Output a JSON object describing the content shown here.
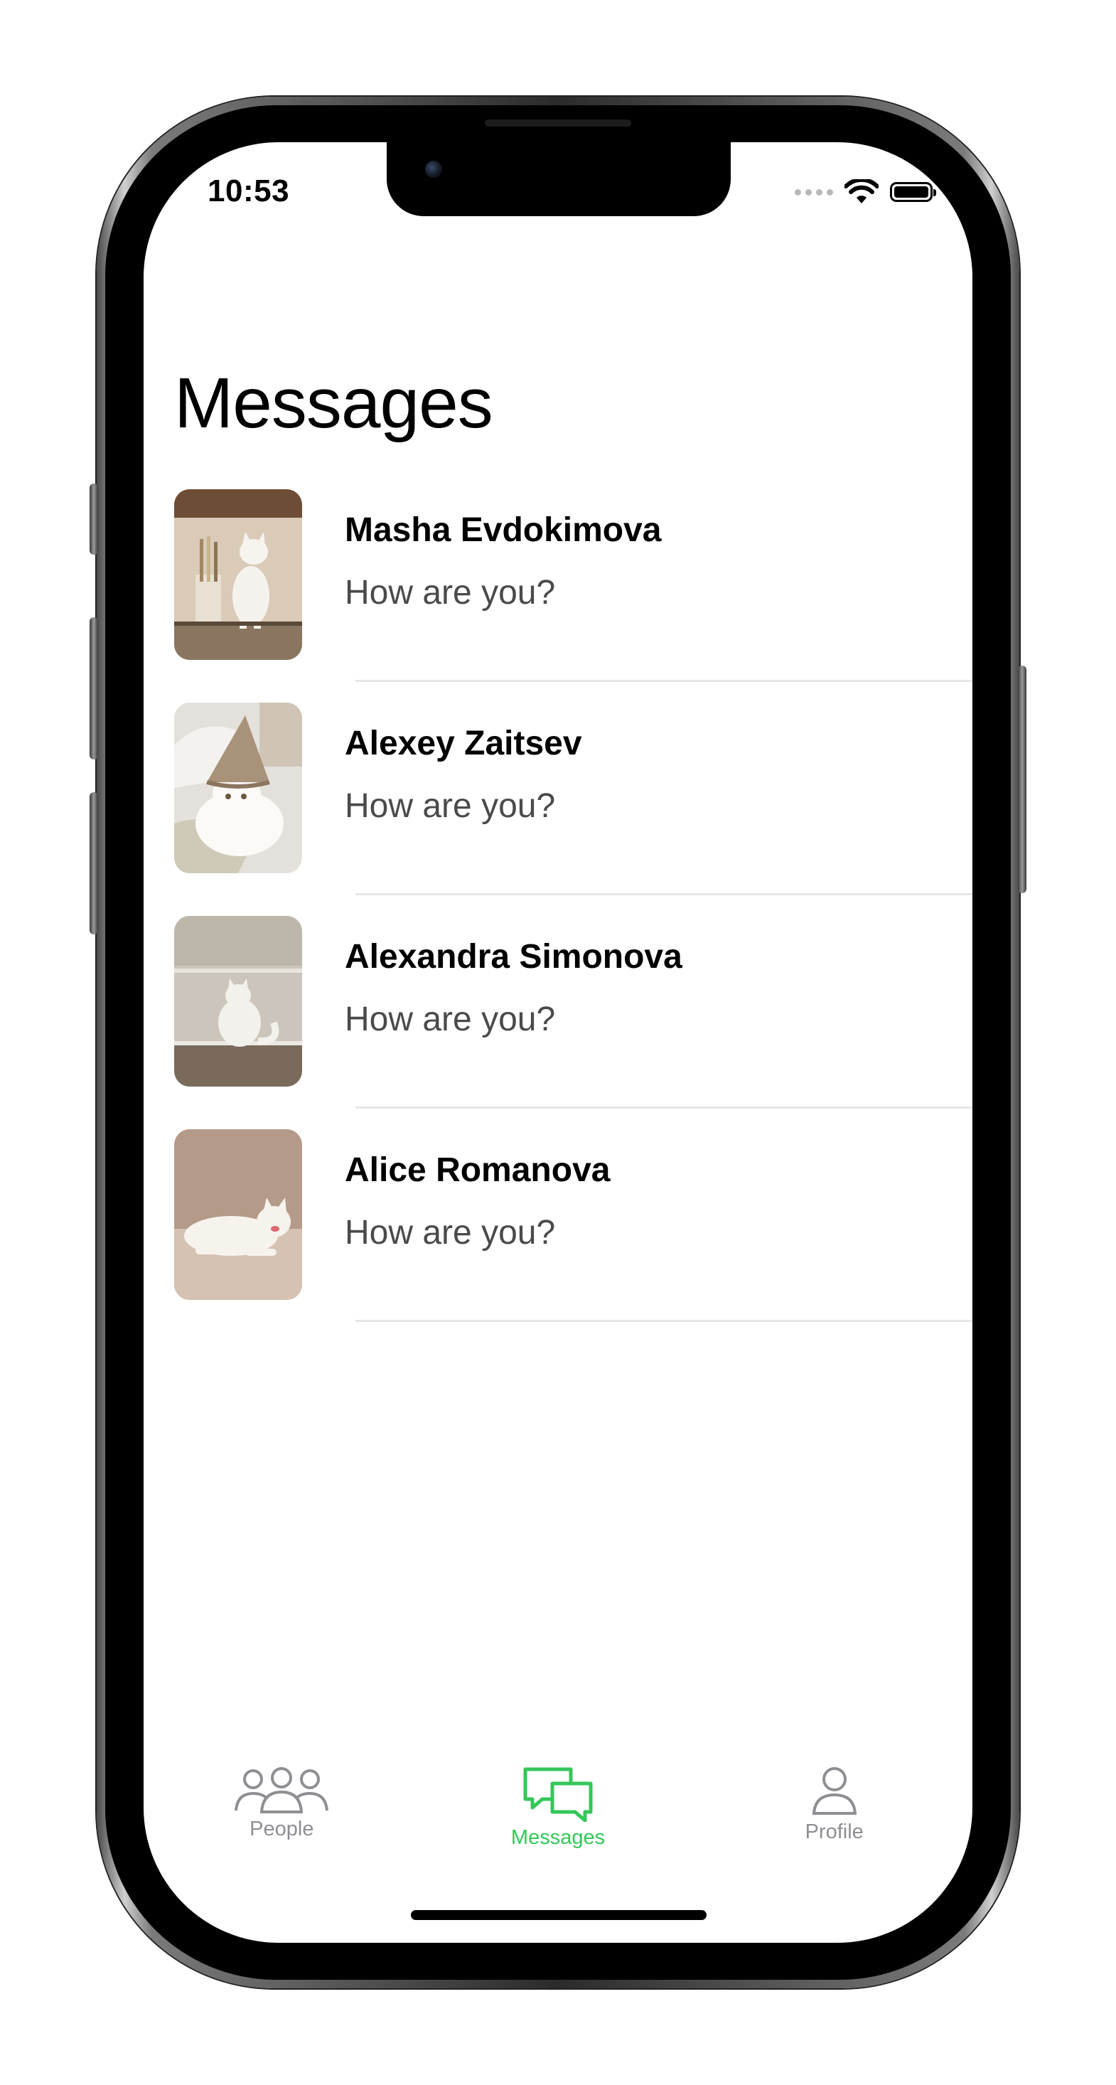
{
  "status_bar": {
    "time": "10:53"
  },
  "header": {
    "title": "Messages"
  },
  "messages": [
    {
      "name": "Masha Evdokimova",
      "preview": "How are you?",
      "avatar_icon": "cat-photo-kitchen"
    },
    {
      "name": "Alexey Zaitsev",
      "preview": "How are you?",
      "avatar_icon": "cat-photo-hat"
    },
    {
      "name": "Alexandra Simonova",
      "preview": "How are you?",
      "avatar_icon": "cat-photo-sitting"
    },
    {
      "name": "Alice Romanova",
      "preview": "How are you?",
      "avatar_icon": "cat-photo-lying"
    }
  ],
  "tab_bar": {
    "tabs": [
      {
        "label": "People",
        "icon": "people-icon",
        "active": false
      },
      {
        "label": "Messages",
        "icon": "chat-bubbles-icon",
        "active": true
      },
      {
        "label": "Profile",
        "icon": "person-icon",
        "active": false
      }
    ]
  },
  "colors": {
    "accent": "#34c759",
    "inactive_tab": "#8e8e93",
    "preview_text": "#4a4a4a",
    "divider": "#e6e6e6"
  }
}
